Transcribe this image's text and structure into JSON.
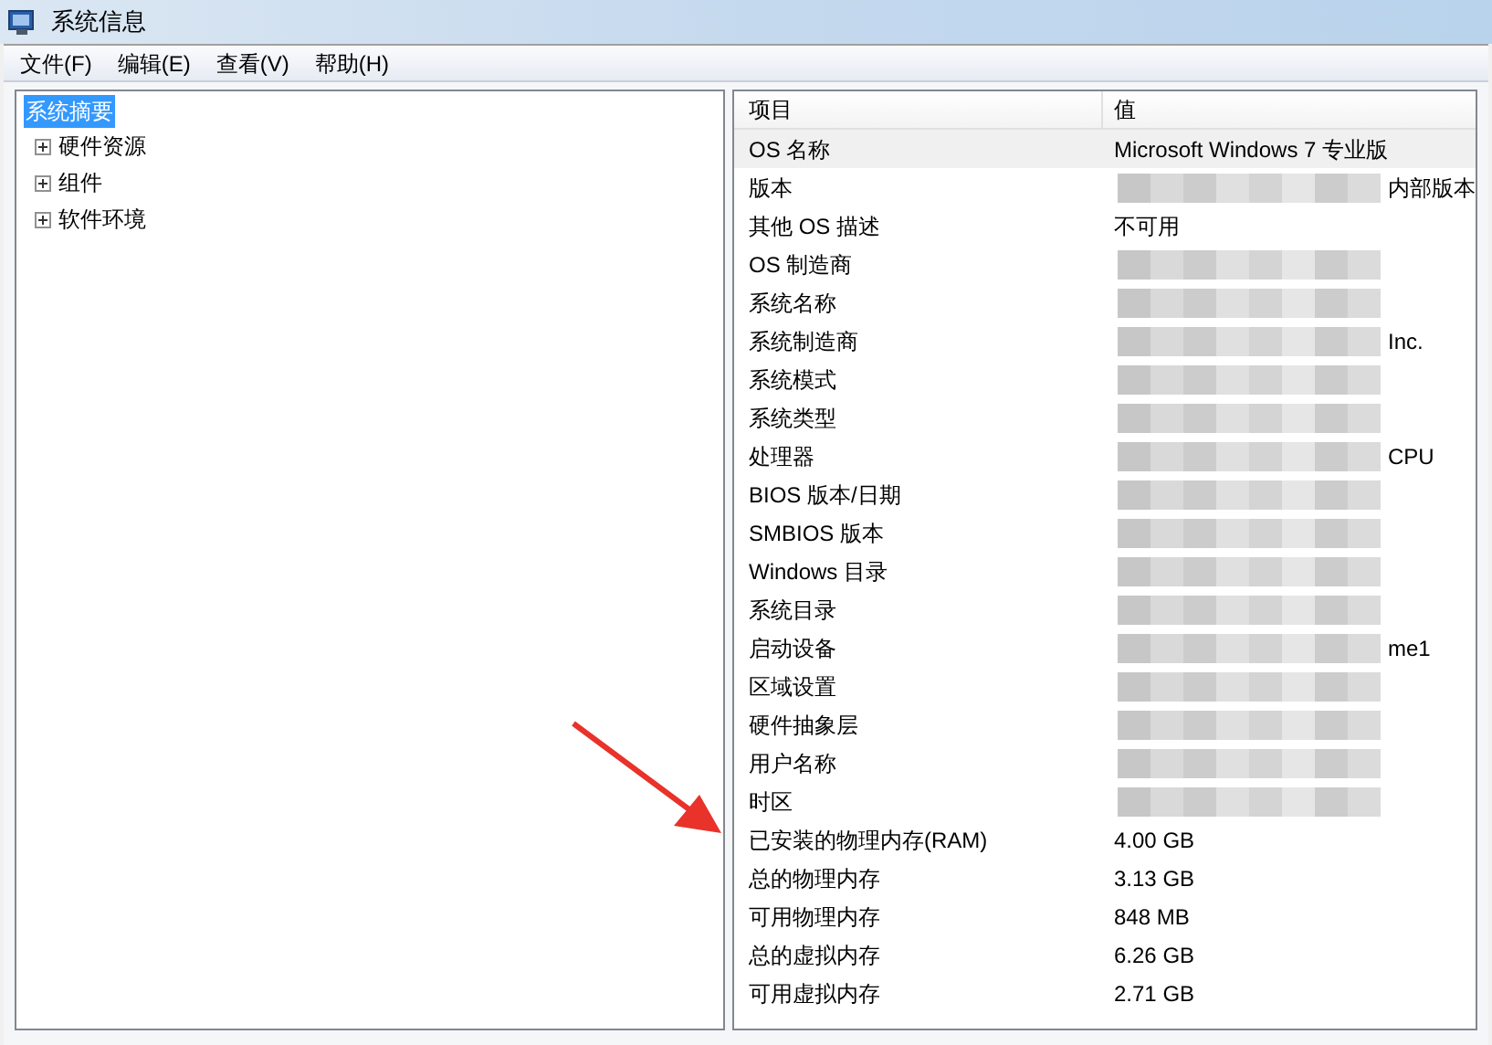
{
  "window": {
    "title": "系统信息"
  },
  "menu": [
    "文件(F)",
    "编辑(E)",
    "查看(V)",
    "帮助(H)"
  ],
  "tree": {
    "label": "系统摘要",
    "selected": true,
    "children": [
      {
        "label": "硬件资源",
        "expanded": false
      },
      {
        "label": "组件",
        "expanded": false
      },
      {
        "label": "软件环境",
        "expanded": false
      }
    ]
  },
  "table": {
    "columns": [
      "项目",
      "值"
    ],
    "rows": [
      {
        "item": "OS 名称",
        "value": "Microsoft Windows 7 专业版",
        "redacted": false,
        "selected": true
      },
      {
        "item": "版本",
        "value": "内部版本",
        "redacted": true,
        "selected": false
      },
      {
        "item": "其他 OS 描述",
        "value": "不可用",
        "redacted": false,
        "selected": false
      },
      {
        "item": "OS 制造商",
        "redacted": true,
        "selected": false
      },
      {
        "item": "系统名称",
        "redacted": true,
        "selected": false
      },
      {
        "item": "系统制造商",
        "value": "Inc.",
        "redacted": true,
        "selected": false
      },
      {
        "item": "系统模式",
        "redacted": true,
        "selected": false
      },
      {
        "item": "系统类型",
        "redacted": true,
        "selected": false
      },
      {
        "item": "处理器",
        "value": "CPU",
        "redacted": true,
        "selected": false
      },
      {
        "item": "BIOS 版本/日期",
        "redacted": true,
        "selected": false
      },
      {
        "item": "SMBIOS 版本",
        "redacted": true,
        "selected": false
      },
      {
        "item": "Windows 目录",
        "redacted": true,
        "selected": false
      },
      {
        "item": "系统目录",
        "redacted": true,
        "selected": false
      },
      {
        "item": "启动设备",
        "value": "me1",
        "redacted": true,
        "selected": false
      },
      {
        "item": "区域设置",
        "redacted": true,
        "selected": false
      },
      {
        "item": "硬件抽象层",
        "redacted": true,
        "selected": false
      },
      {
        "item": "用户名称",
        "redacted": true,
        "selected": false
      },
      {
        "item": "时区",
        "redacted": true,
        "selected": false
      },
      {
        "item": "已安装的物理内存(RAM)",
        "value": "4.00 GB",
        "redacted": false,
        "selected": false
      },
      {
        "item": "总的物理内存",
        "value": "3.13 GB",
        "redacted": false,
        "selected": false
      },
      {
        "item": "可用物理内存",
        "value": "848 MB",
        "redacted": false,
        "selected": false
      },
      {
        "item": "总的虚拟内存",
        "value": "6.26 GB",
        "redacted": false,
        "selected": false
      },
      {
        "item": "可用虚拟内存",
        "value": "2.71 GB",
        "redacted": false,
        "selected": false
      }
    ]
  }
}
